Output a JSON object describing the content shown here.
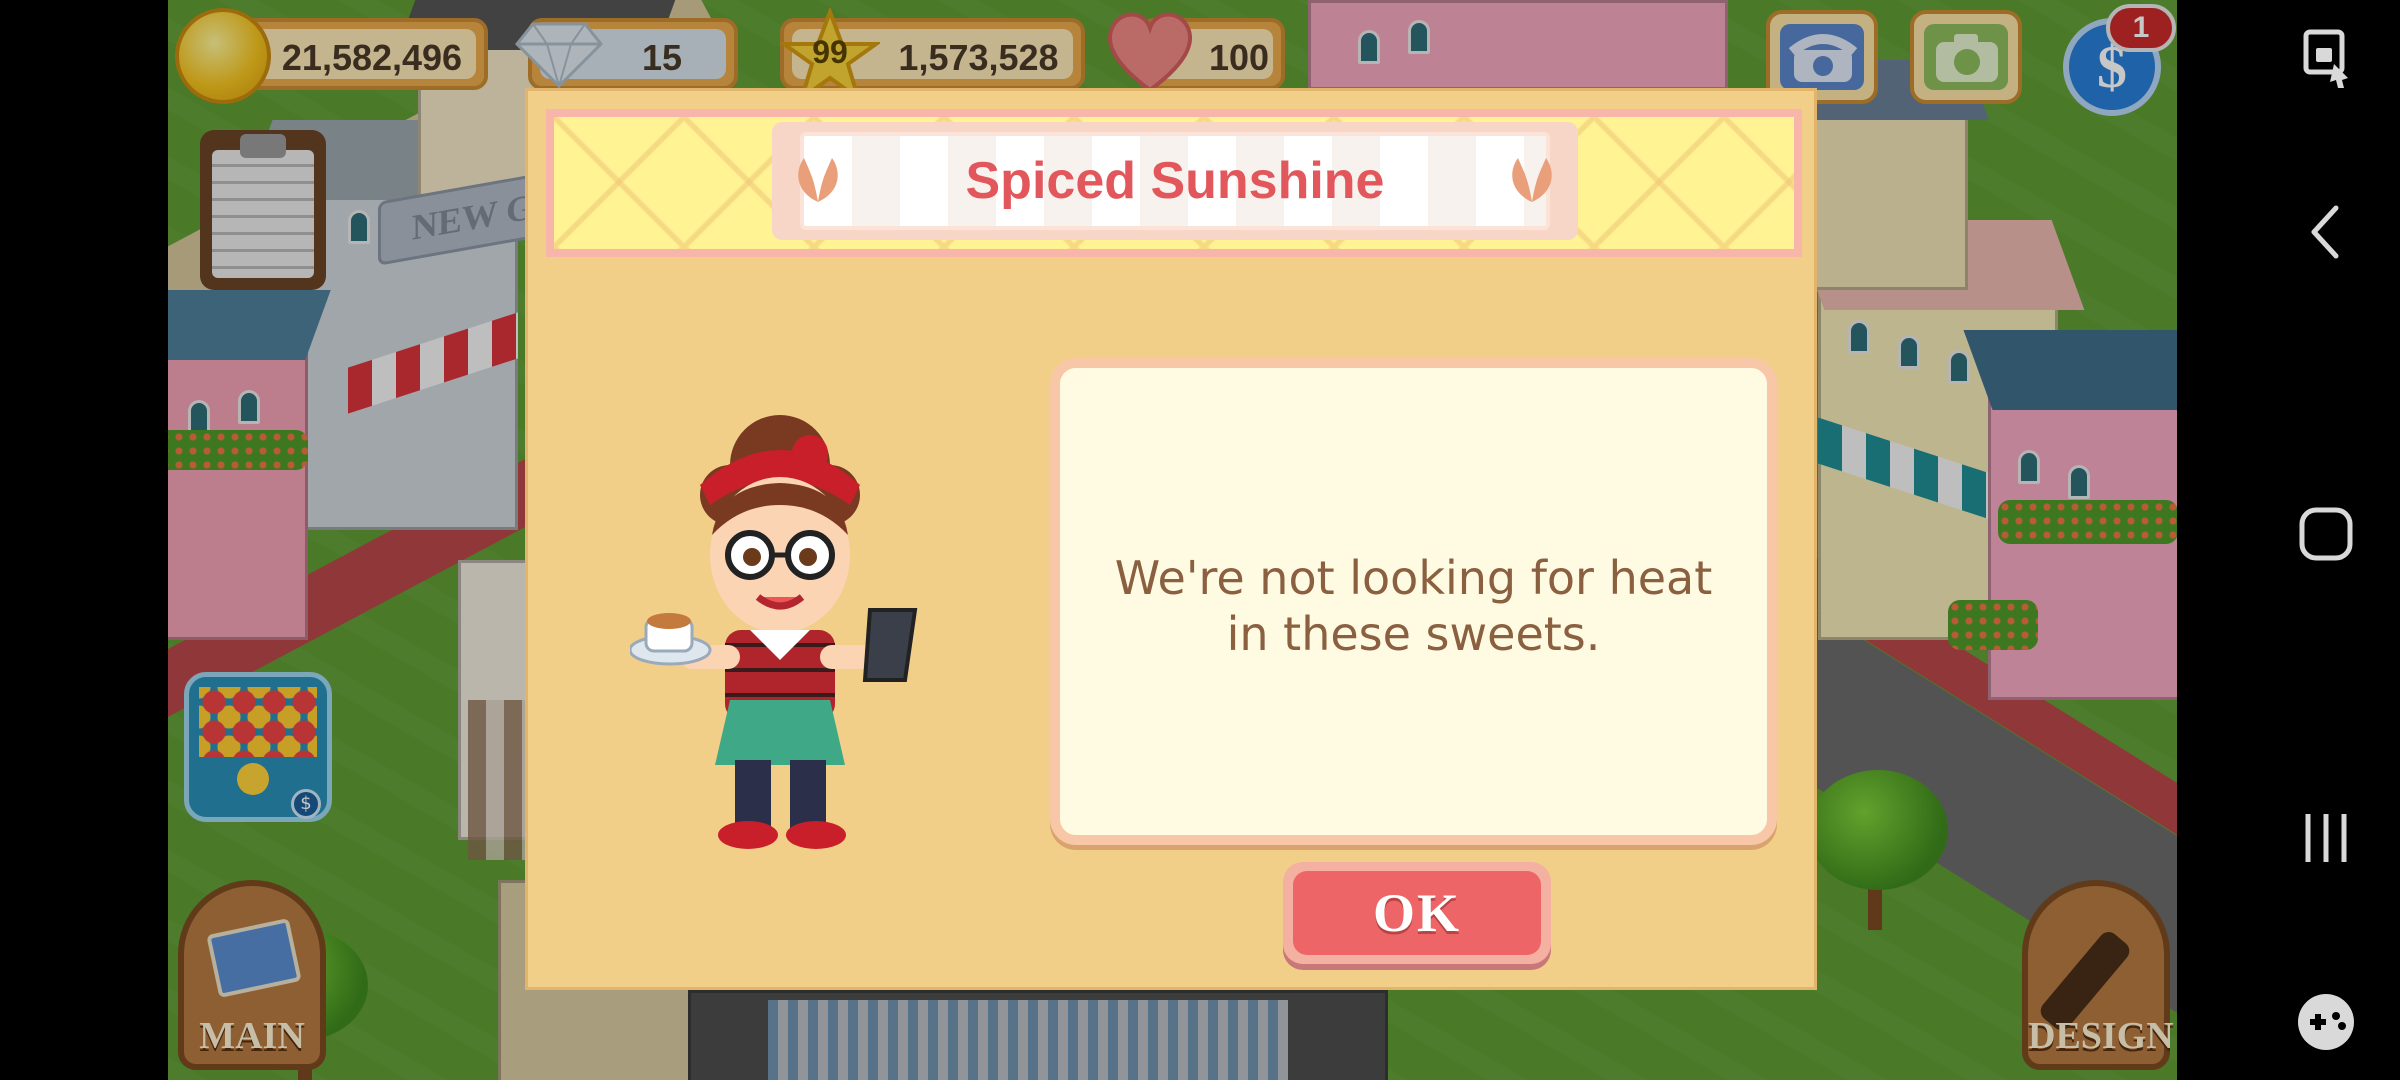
{
  "hud": {
    "coins": "21,582,496",
    "gems": "15",
    "level": "99",
    "xp": "1,573,528",
    "hearts": "100",
    "notification_count": "1"
  },
  "dialog": {
    "title": "Spiced Sunshine",
    "message": "We're not looking for heat in these sweets.",
    "ok_label": "OK"
  },
  "buttons": {
    "main_label": "MAIN",
    "design_label": "DESIGN",
    "new_sign": "NEW G"
  },
  "icons": {
    "coin": "coin-icon",
    "gem": "gem-icon",
    "star": "star-icon",
    "heart": "heart-icon",
    "phone": "phone-icon",
    "camera": "camera-icon",
    "cash": "cash-icon",
    "clipboard": "clipboard-icon",
    "bubble_game": "bubble-game-icon",
    "screenshot": "screenshot-lock-icon",
    "back": "back-icon",
    "home": "home-icon",
    "recents": "recents-icon",
    "game_tools": "game-tools-icon"
  },
  "colors": {
    "title": "#e2575b",
    "ok_button": "#ee6567",
    "dialog_bg": "#f2cf89",
    "message_text": "#8a6040"
  }
}
